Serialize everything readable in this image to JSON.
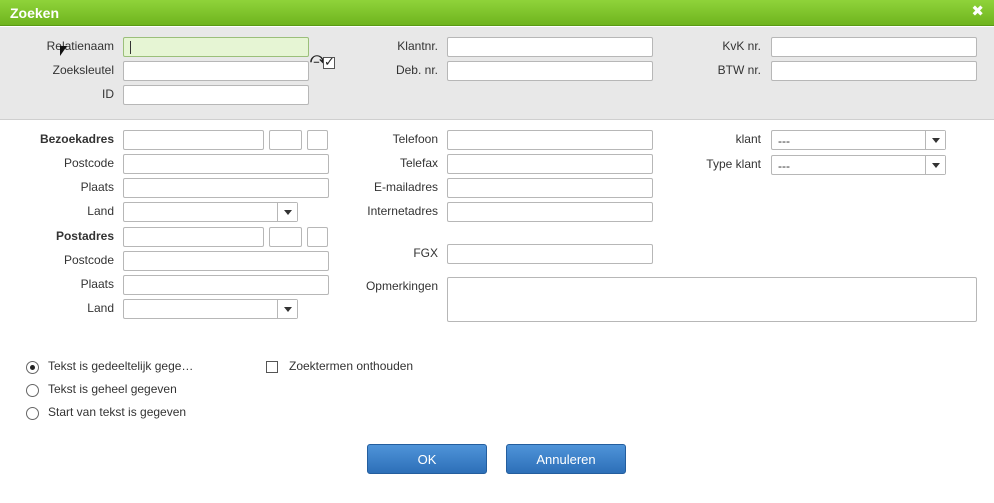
{
  "dialog": {
    "title": "Zoeken"
  },
  "top": {
    "relatienaam": {
      "label": "Relatienaam",
      "value": ""
    },
    "zoeksleutel": {
      "label": "Zoeksleutel",
      "value": ""
    },
    "id": {
      "label": "ID",
      "value": ""
    },
    "klantnr": {
      "label": "Klantnr.",
      "value": ""
    },
    "debnr": {
      "label": "Deb. nr.",
      "value": ""
    },
    "kvk": {
      "label": "KvK nr.",
      "value": ""
    },
    "btw": {
      "label": "BTW nr.",
      "value": ""
    },
    "link_checked": true
  },
  "address": {
    "bezoek_label": "Bezoekadres",
    "postcode_label": "Postcode",
    "plaats_label": "Plaats",
    "land_label": "Land",
    "post_label": "Postadres",
    "postcode2_label": "Postcode",
    "plaats2_label": "Plaats",
    "land2_label": "Land"
  },
  "contact": {
    "telefoon": "Telefoon",
    "telefax": "Telefax",
    "email": "E-mailadres",
    "internet": "Internetadres",
    "fgx": "FGX",
    "opmerkingen": "Opmerkingen"
  },
  "right": {
    "klant_label": "klant",
    "klant_value": "---",
    "type_label": "Type klant",
    "type_value": "---"
  },
  "options": {
    "radio1": "Tekst is gedeeltelijk gege…",
    "radio2": "Tekst is geheel gegeven",
    "radio3": "Start van tekst is gegeven",
    "selected": 1,
    "remember": "Zoektermen onthouden",
    "remember_checked": false
  },
  "buttons": {
    "ok": "OK",
    "cancel": "Annuleren"
  },
  "icons": {
    "close": "close-icon",
    "link": "link-arrow-icon",
    "dropdown": "chevron-down-icon"
  }
}
